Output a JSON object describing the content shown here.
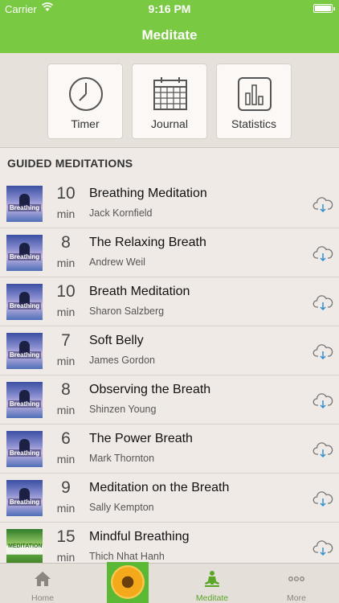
{
  "status": {
    "carrier": "Carrier",
    "time": "9:16 PM"
  },
  "nav": {
    "title": "Meditate"
  },
  "tools": [
    {
      "label": "Timer",
      "icon": "clock-icon"
    },
    {
      "label": "Journal",
      "icon": "calendar-icon"
    },
    {
      "label": "Statistics",
      "icon": "bar-chart-icon"
    }
  ],
  "section": {
    "title": "GUIDED MEDITATIONS"
  },
  "meditations": [
    {
      "minutes": "10",
      "unit": "min",
      "title": "Breathing Meditation",
      "author": "Jack Kornfield",
      "cover": "Breathing"
    },
    {
      "minutes": "8",
      "unit": "min",
      "title": "The Relaxing Breath",
      "author": "Andrew Weil",
      "cover": "Breathing"
    },
    {
      "minutes": "10",
      "unit": "min",
      "title": "Breath Meditation",
      "author": "Sharon Salzberg",
      "cover": "Breathing"
    },
    {
      "minutes": "7",
      "unit": "min",
      "title": "Soft Belly",
      "author": "James Gordon",
      "cover": "Breathing"
    },
    {
      "minutes": "8",
      "unit": "min",
      "title": "Observing the Breath",
      "author": "Shinzen Young",
      "cover": "Breathing"
    },
    {
      "minutes": "6",
      "unit": "min",
      "title": "The Power Breath",
      "author": "Mark Thornton",
      "cover": "Breathing"
    },
    {
      "minutes": "9",
      "unit": "min",
      "title": "Meditation on the Breath",
      "author": "Sally Kempton",
      "cover": "Breathing"
    },
    {
      "minutes": "15",
      "unit": "min",
      "title": "Mindful Breathing",
      "author": "Thich Nhat Hanh",
      "cover": "MEDITATION"
    }
  ],
  "tabbar": {
    "home": "Home",
    "meditate": "Meditate",
    "more": "More"
  },
  "colors": {
    "accent": "#7ac943",
    "active_tab": "#5aa628",
    "cloud": "#2f8fd1"
  }
}
